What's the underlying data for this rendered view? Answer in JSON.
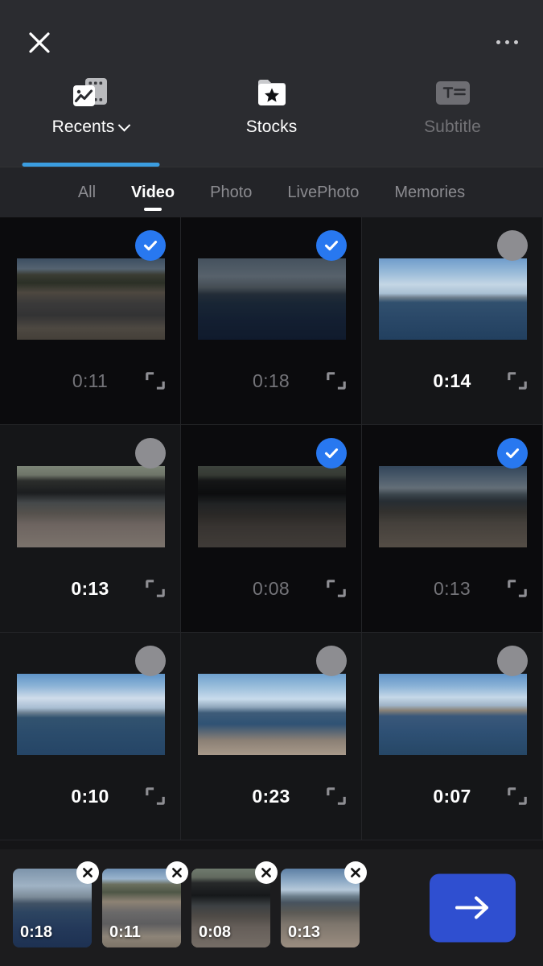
{
  "topbar": {
    "close_icon": "close-icon",
    "more_icon": "more-options-icon"
  },
  "source_tabs": [
    {
      "label": "Recents",
      "icon": "filmstrip-photo-icon",
      "active": true,
      "has_chevron": true
    },
    {
      "label": "Stocks",
      "icon": "folder-star-icon",
      "active": false,
      "has_chevron": false
    },
    {
      "label": "Subtitle",
      "icon": "subtitle-text-icon",
      "active": false,
      "has_chevron": false
    }
  ],
  "filter_tabs": [
    {
      "label": "All",
      "active": false
    },
    {
      "label": "Video",
      "active": true
    },
    {
      "label": "Photo",
      "active": false
    },
    {
      "label": "LivePhoto",
      "active": false
    },
    {
      "label": "Memories",
      "active": false
    }
  ],
  "grid": {
    "items": [
      {
        "duration": "0:11",
        "selected": true,
        "scene": "street-city-cars",
        "expand_icon": "expand-icon",
        "check_icon": "check-icon"
      },
      {
        "duration": "0:18",
        "selected": true,
        "scene": "river-ship-embankment",
        "expand_icon": "expand-icon",
        "check_icon": "check-icon"
      },
      {
        "duration": "0:14",
        "selected": false,
        "scene": "river-clouds-wide",
        "expand_icon": "expand-icon",
        "check_icon": "check-icon"
      },
      {
        "duration": "0:13",
        "selected": false,
        "scene": "underpass-tunnel-road",
        "expand_icon": "expand-icon",
        "check_icon": "check-icon"
      },
      {
        "duration": "0:08",
        "selected": true,
        "scene": "underpass-tunnel-cars",
        "expand_icon": "expand-icon",
        "check_icon": "check-icon"
      },
      {
        "duration": "0:13",
        "selected": true,
        "scene": "bridge-road-lamps",
        "expand_icon": "expand-icon",
        "check_icon": "check-icon"
      },
      {
        "duration": "0:10",
        "selected": false,
        "scene": "pier-boats-clouds",
        "expand_icon": "expand-icon",
        "check_icon": "check-icon"
      },
      {
        "duration": "0:23",
        "selected": false,
        "scene": "quay-person-bridge",
        "expand_icon": "expand-icon",
        "check_icon": "check-icon"
      },
      {
        "duration": "0:07",
        "selected": false,
        "scene": "river-city-skyline",
        "expand_icon": "expand-icon",
        "check_icon": "check-icon"
      }
    ]
  },
  "bottombar": {
    "selected_clips": [
      {
        "duration": "0:18",
        "scene": "river-ship-embankment",
        "remove_icon": "close-icon"
      },
      {
        "duration": "0:11",
        "scene": "street-city-cars",
        "remove_icon": "close-icon"
      },
      {
        "duration": "0:08",
        "scene": "underpass-tunnel-cars",
        "remove_icon": "close-icon"
      },
      {
        "duration": "0:13",
        "scene": "bridge-road-lamps",
        "remove_icon": "close-icon"
      }
    ],
    "next_button": {
      "icon": "arrow-right-icon",
      "color": "#2f4fd0"
    }
  },
  "colors": {
    "accent_blue": "#2878f0",
    "tab_underline": "#3b9de0",
    "next_button": "#2f4fd0",
    "topbar_bg": "#2b2c30",
    "grid_bg": "#151517"
  }
}
